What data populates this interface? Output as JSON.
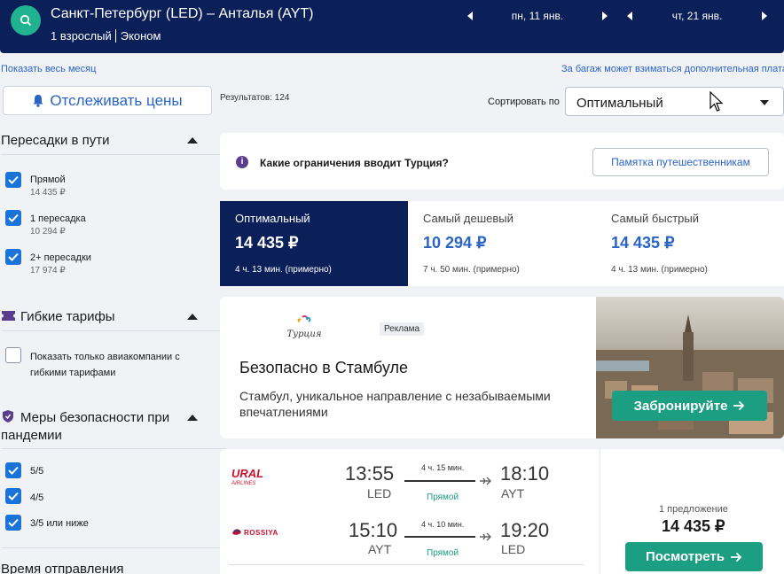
{
  "header": {
    "route": "Санкт-Петербург (LED) – Анталья (AYT)",
    "passengers": "1 взрослый",
    "cabin": "Эконом",
    "date_out": "пн, 11 янв.",
    "date_back": "чт, 21 янв."
  },
  "links": {
    "show_month": "Показать весь месяц",
    "baggage_note": "За багаж может взиматься дополнительная плата"
  },
  "sidebar": {
    "track_prices": "Отслеживать цены",
    "stops_title": "Пересадки в пути",
    "stops": [
      {
        "label": "Прямой",
        "price": "14 435 ₽",
        "checked": true
      },
      {
        "label": "1 пересадка",
        "price": "10 294 ₽",
        "checked": true
      },
      {
        "label": "2+ пересадки",
        "price": "17 974 ₽",
        "checked": true
      }
    ],
    "flex_title": "Гибкие тарифы",
    "flex_option_line1": "Показать только авиакомпании с",
    "flex_option_line2": "гибкими тарифами",
    "safety_title_line1": "Меры безопасности при",
    "safety_title_line2": "пандемии",
    "safety": [
      {
        "label": "5/5",
        "checked": true
      },
      {
        "label": "4/5",
        "checked": true
      },
      {
        "label": "3/5 или ниже",
        "checked": true
      }
    ],
    "departure_title": "Время отправления"
  },
  "main": {
    "results": "Результатов: 124",
    "sort_label": "Сортировать по",
    "sort_value": "Оптимальный",
    "info_question": "Какие ограничения вводит Турция?",
    "info_button": "Памятка путешественникам",
    "tabs": [
      {
        "name": "Оптимальный",
        "price": "14 435 ₽",
        "duration": "4 ч. 13 мин. (примерно)"
      },
      {
        "name": "Самый дешевый",
        "price": "10 294 ₽",
        "duration": "7 ч. 50 мин. (примерно)"
      },
      {
        "name": "Самый быстрый",
        "price": "14 435 ₽",
        "duration": "4 ч. 13 мин. (примерно)"
      }
    ],
    "ad": {
      "logo_text": "Турция",
      "badge": "Реклама",
      "title": "Безопасно в Стамбуле",
      "text": "Стамбул, уникальное направление с незабываемыми впечатлениями",
      "cta": "Забронируйте"
    },
    "flight": {
      "outbound": {
        "airline": "URAL AIRLINES",
        "dep_time": "13:55",
        "dep_code": "LED",
        "duration": "4 ч. 15 мин.",
        "type": "Прямой",
        "arr_time": "18:10",
        "arr_code": "AYT"
      },
      "inbound": {
        "airline": "ROSSIYA",
        "dep_time": "15:10",
        "dep_code": "AYT",
        "duration": "4 ч. 10 мин.",
        "type": "Прямой",
        "arr_time": "19:20",
        "arr_code": "LED"
      },
      "offers": "1 предложение",
      "price": "14 435 ₽",
      "view": "Посмотреть"
    }
  },
  "colors": {
    "header_bg": "#0b1f59",
    "accent_green": "#1c9e82",
    "link_blue": "#2a64c8",
    "checkbox_blue": "#1a73d9"
  }
}
